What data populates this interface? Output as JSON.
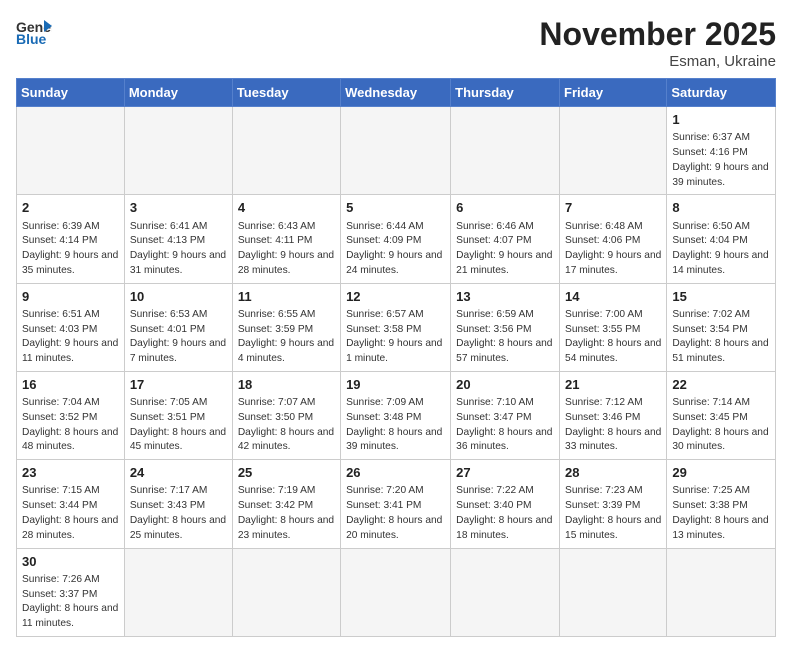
{
  "logo": {
    "text_general": "General",
    "text_blue": "Blue"
  },
  "title": "November 2025",
  "subtitle": "Esman, Ukraine",
  "days_of_week": [
    "Sunday",
    "Monday",
    "Tuesday",
    "Wednesday",
    "Thursday",
    "Friday",
    "Saturday"
  ],
  "weeks": [
    [
      {
        "day": "",
        "info": ""
      },
      {
        "day": "",
        "info": ""
      },
      {
        "day": "",
        "info": ""
      },
      {
        "day": "",
        "info": ""
      },
      {
        "day": "",
        "info": ""
      },
      {
        "day": "",
        "info": ""
      },
      {
        "day": "1",
        "info": "Sunrise: 6:37 AM\nSunset: 4:16 PM\nDaylight: 9 hours and 39 minutes."
      }
    ],
    [
      {
        "day": "2",
        "info": "Sunrise: 6:39 AM\nSunset: 4:14 PM\nDaylight: 9 hours and 35 minutes."
      },
      {
        "day": "3",
        "info": "Sunrise: 6:41 AM\nSunset: 4:13 PM\nDaylight: 9 hours and 31 minutes."
      },
      {
        "day": "4",
        "info": "Sunrise: 6:43 AM\nSunset: 4:11 PM\nDaylight: 9 hours and 28 minutes."
      },
      {
        "day": "5",
        "info": "Sunrise: 6:44 AM\nSunset: 4:09 PM\nDaylight: 9 hours and 24 minutes."
      },
      {
        "day": "6",
        "info": "Sunrise: 6:46 AM\nSunset: 4:07 PM\nDaylight: 9 hours and 21 minutes."
      },
      {
        "day": "7",
        "info": "Sunrise: 6:48 AM\nSunset: 4:06 PM\nDaylight: 9 hours and 17 minutes."
      },
      {
        "day": "8",
        "info": "Sunrise: 6:50 AM\nSunset: 4:04 PM\nDaylight: 9 hours and 14 minutes."
      }
    ],
    [
      {
        "day": "9",
        "info": "Sunrise: 6:51 AM\nSunset: 4:03 PM\nDaylight: 9 hours and 11 minutes."
      },
      {
        "day": "10",
        "info": "Sunrise: 6:53 AM\nSunset: 4:01 PM\nDaylight: 9 hours and 7 minutes."
      },
      {
        "day": "11",
        "info": "Sunrise: 6:55 AM\nSunset: 3:59 PM\nDaylight: 9 hours and 4 minutes."
      },
      {
        "day": "12",
        "info": "Sunrise: 6:57 AM\nSunset: 3:58 PM\nDaylight: 9 hours and 1 minute."
      },
      {
        "day": "13",
        "info": "Sunrise: 6:59 AM\nSunset: 3:56 PM\nDaylight: 8 hours and 57 minutes."
      },
      {
        "day": "14",
        "info": "Sunrise: 7:00 AM\nSunset: 3:55 PM\nDaylight: 8 hours and 54 minutes."
      },
      {
        "day": "15",
        "info": "Sunrise: 7:02 AM\nSunset: 3:54 PM\nDaylight: 8 hours and 51 minutes."
      }
    ],
    [
      {
        "day": "16",
        "info": "Sunrise: 7:04 AM\nSunset: 3:52 PM\nDaylight: 8 hours and 48 minutes."
      },
      {
        "day": "17",
        "info": "Sunrise: 7:05 AM\nSunset: 3:51 PM\nDaylight: 8 hours and 45 minutes."
      },
      {
        "day": "18",
        "info": "Sunrise: 7:07 AM\nSunset: 3:50 PM\nDaylight: 8 hours and 42 minutes."
      },
      {
        "day": "19",
        "info": "Sunrise: 7:09 AM\nSunset: 3:48 PM\nDaylight: 8 hours and 39 minutes."
      },
      {
        "day": "20",
        "info": "Sunrise: 7:10 AM\nSunset: 3:47 PM\nDaylight: 8 hours and 36 minutes."
      },
      {
        "day": "21",
        "info": "Sunrise: 7:12 AM\nSunset: 3:46 PM\nDaylight: 8 hours and 33 minutes."
      },
      {
        "day": "22",
        "info": "Sunrise: 7:14 AM\nSunset: 3:45 PM\nDaylight: 8 hours and 30 minutes."
      }
    ],
    [
      {
        "day": "23",
        "info": "Sunrise: 7:15 AM\nSunset: 3:44 PM\nDaylight: 8 hours and 28 minutes."
      },
      {
        "day": "24",
        "info": "Sunrise: 7:17 AM\nSunset: 3:43 PM\nDaylight: 8 hours and 25 minutes."
      },
      {
        "day": "25",
        "info": "Sunrise: 7:19 AM\nSunset: 3:42 PM\nDaylight: 8 hours and 23 minutes."
      },
      {
        "day": "26",
        "info": "Sunrise: 7:20 AM\nSunset: 3:41 PM\nDaylight: 8 hours and 20 minutes."
      },
      {
        "day": "27",
        "info": "Sunrise: 7:22 AM\nSunset: 3:40 PM\nDaylight: 8 hours and 18 minutes."
      },
      {
        "day": "28",
        "info": "Sunrise: 7:23 AM\nSunset: 3:39 PM\nDaylight: 8 hours and 15 minutes."
      },
      {
        "day": "29",
        "info": "Sunrise: 7:25 AM\nSunset: 3:38 PM\nDaylight: 8 hours and 13 minutes."
      }
    ],
    [
      {
        "day": "30",
        "info": "Sunrise: 7:26 AM\nSunset: 3:37 PM\nDaylight: 8 hours and 11 minutes."
      },
      {
        "day": "",
        "info": ""
      },
      {
        "day": "",
        "info": ""
      },
      {
        "day": "",
        "info": ""
      },
      {
        "day": "",
        "info": ""
      },
      {
        "day": "",
        "info": ""
      },
      {
        "day": "",
        "info": ""
      }
    ]
  ]
}
